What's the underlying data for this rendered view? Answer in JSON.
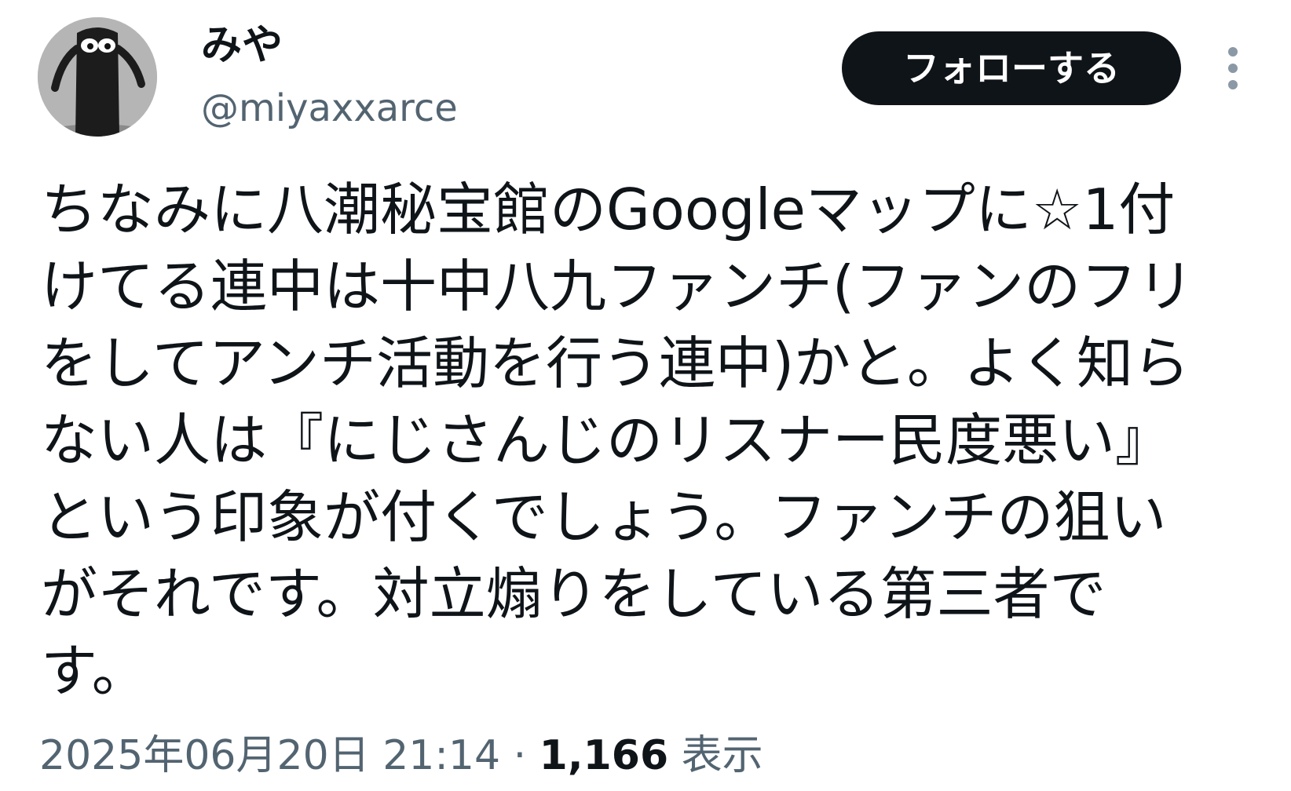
{
  "user": {
    "display_name": "みや",
    "handle": "@miyaxxarce"
  },
  "actions": {
    "follow_label": "フォローする",
    "more_icon": "more-vertical-icon"
  },
  "tweet": {
    "text": "ちなみに八潮秘宝館のGoogleマップに☆1付\nけてる連中は十中八九ファンチ(ファンのフリ\nをしてアンチ活動を行う連中)かと。よく知ら\nない人は『にじさんじのリスナー民度悪い』\nという印象が付くでしょう。ファンチの狙い\nがそれです。対立煽りをしている第三者で\nす。"
  },
  "meta": {
    "timestamp": "2025年06月20日 21:14",
    "separator": "·",
    "views_count": "1,166",
    "views_label": "表示"
  },
  "colors": {
    "text": "#0f1419",
    "secondary": "#536471",
    "follow_bg": "#0f1419",
    "follow_text": "#ffffff",
    "more_dots": "#8b98a5"
  }
}
